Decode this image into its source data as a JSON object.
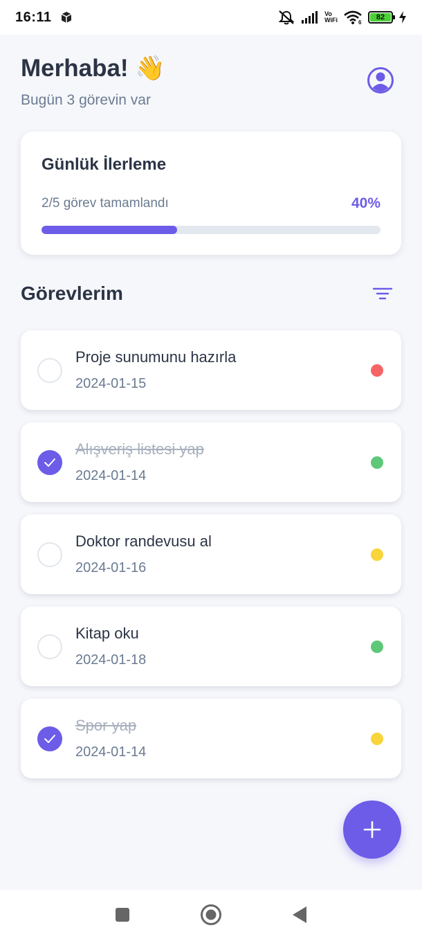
{
  "status_bar": {
    "time": "16:11",
    "vo_top": "Vo",
    "vo_bottom": "WiFi",
    "wifi_sub": "6",
    "battery": "82"
  },
  "header": {
    "greeting": "Merhaba! 👋",
    "subtitle": "Bugün 3 görevin var"
  },
  "progress": {
    "title": "Günlük İlerleme",
    "summary": "2/5 görev tamamlandı",
    "percent_label": "40%",
    "fraction": 0.4
  },
  "tasks_section": {
    "title": "Görevlerim"
  },
  "tasks": [
    {
      "title": "Proje sunumunu hazırla",
      "date": "2024-01-15",
      "done": false,
      "priority_color": "#f56565"
    },
    {
      "title": "Alışveriş listesi yap",
      "date": "2024-01-14",
      "done": true,
      "priority_color": "#5cc878"
    },
    {
      "title": "Doktor randevusu al",
      "date": "2024-01-16",
      "done": false,
      "priority_color": "#f9d43a"
    },
    {
      "title": "Kitap oku",
      "date": "2024-01-18",
      "done": false,
      "priority_color": "#5cc878"
    },
    {
      "title": "Spor yap",
      "date": "2024-01-14",
      "done": true,
      "priority_color": "#f9d43a"
    }
  ],
  "colors": {
    "accent": "#6c5ce7",
    "background": "#f6f7fb"
  },
  "icons": {
    "profile": "account-circle-icon",
    "filter": "filter-icon",
    "add": "plus-icon"
  }
}
